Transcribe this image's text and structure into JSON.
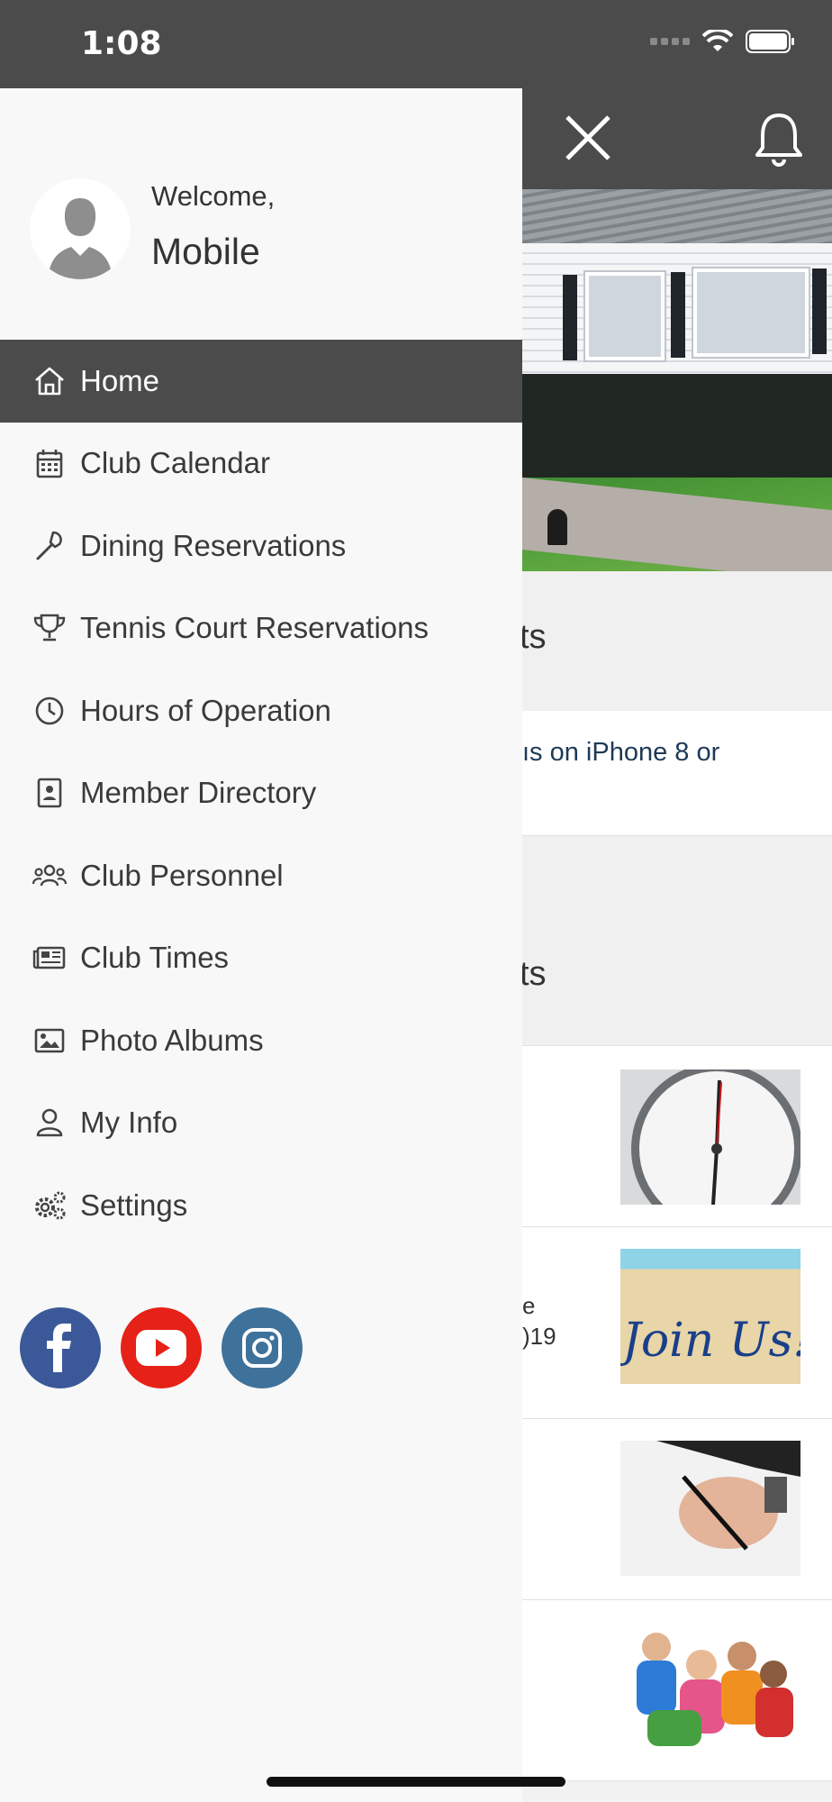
{
  "status_bar": {
    "time": "1:08"
  },
  "drawer": {
    "welcome": "Welcome,",
    "username": "Mobile",
    "menu": [
      {
        "label": "Home",
        "icon": "home-icon",
        "active": true
      },
      {
        "label": "Club Calendar",
        "icon": "calendar-icon"
      },
      {
        "label": "Dining Reservations",
        "icon": "utensils-icon"
      },
      {
        "label": "Tennis Court Reservations",
        "icon": "trophy-icon"
      },
      {
        "label": "Hours of Operation",
        "icon": "clock-icon"
      },
      {
        "label": "Member Directory",
        "icon": "address-book-icon"
      },
      {
        "label": "Club Personnel",
        "icon": "users-icon"
      },
      {
        "label": "Club Times",
        "icon": "newspaper-icon"
      },
      {
        "label": "Photo Albums",
        "icon": "image-icon"
      },
      {
        "label": "My Info",
        "icon": "user-icon"
      },
      {
        "label": "Settings",
        "icon": "gears-icon"
      }
    ],
    "social": [
      {
        "name": "facebook",
        "color": "#3b5998"
      },
      {
        "name": "youtube",
        "color": "#e62117"
      },
      {
        "name": "instagram",
        "color": "#3f729b"
      }
    ]
  },
  "background": {
    "section1_title": "ts",
    "alert_text": "ıs on iPhone 8 or",
    "section2_title": "ts",
    "news": [
      {
        "line1": "",
        "line2": ""
      },
      {
        "line1": "e",
        "line2": ")19",
        "thumb_text": "Join Us!"
      },
      {
        "line1": "",
        "line2": ""
      },
      {
        "line1": "",
        "line2": ""
      }
    ]
  },
  "colors": {
    "header": "#4b4b4b",
    "drawer_bg": "#f8f8f8",
    "active_item": "#4b4b4b",
    "link_text": "#1d3a56"
  }
}
